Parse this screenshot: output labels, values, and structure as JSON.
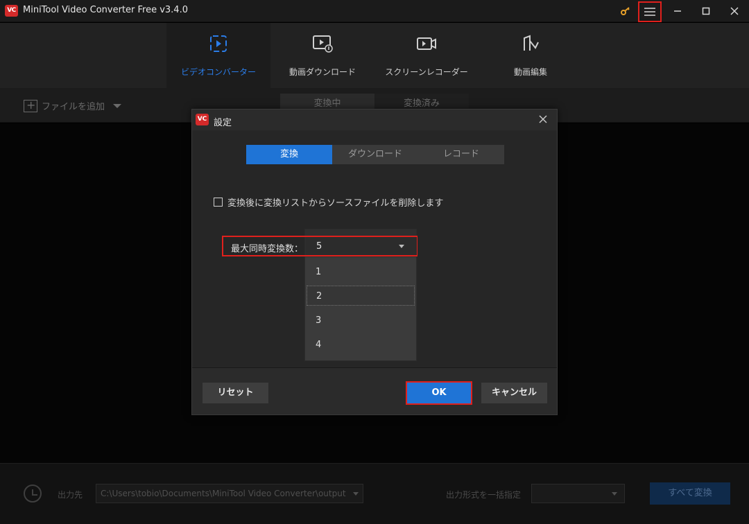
{
  "app": {
    "title": "MiniTool Video Converter Free v3.4.0",
    "logo": "VC"
  },
  "colors": {
    "accent": "#1f74d6",
    "highlight": "#e0201c",
    "brand": "#d42a2a"
  },
  "nav": {
    "items": [
      {
        "label": "ビデオコンバーター",
        "icon": "convert-icon"
      },
      {
        "label": "動画ダウンロード",
        "icon": "download-video-icon"
      },
      {
        "label": "スクリーンレコーダー",
        "icon": "screen-record-icon"
      },
      {
        "label": "動画編集",
        "icon": "video-edit-icon"
      }
    ]
  },
  "toolbar": {
    "add_file": "ファイルを追加",
    "tabs": [
      "変換中",
      "変換済み"
    ]
  },
  "bottom": {
    "output_label": "出力先",
    "output_path": "C:\\Users\\tobio\\Documents\\MiniTool Video Converter\\output",
    "format_label": "出力形式を一括指定",
    "convert_all": "すべて変換"
  },
  "dialog": {
    "title": "設定",
    "logo": "VC",
    "tabs": [
      "変換",
      "ダウンロード",
      "レコード"
    ],
    "checkbox_label": "変換後に変換リストからソースファイルを削除します",
    "max_label": "最大同時変換数：",
    "max_value": "5",
    "options": [
      "1",
      "2",
      "3",
      "4"
    ],
    "reset": "リセット",
    "ok": "OK",
    "cancel": "キャンセル"
  }
}
